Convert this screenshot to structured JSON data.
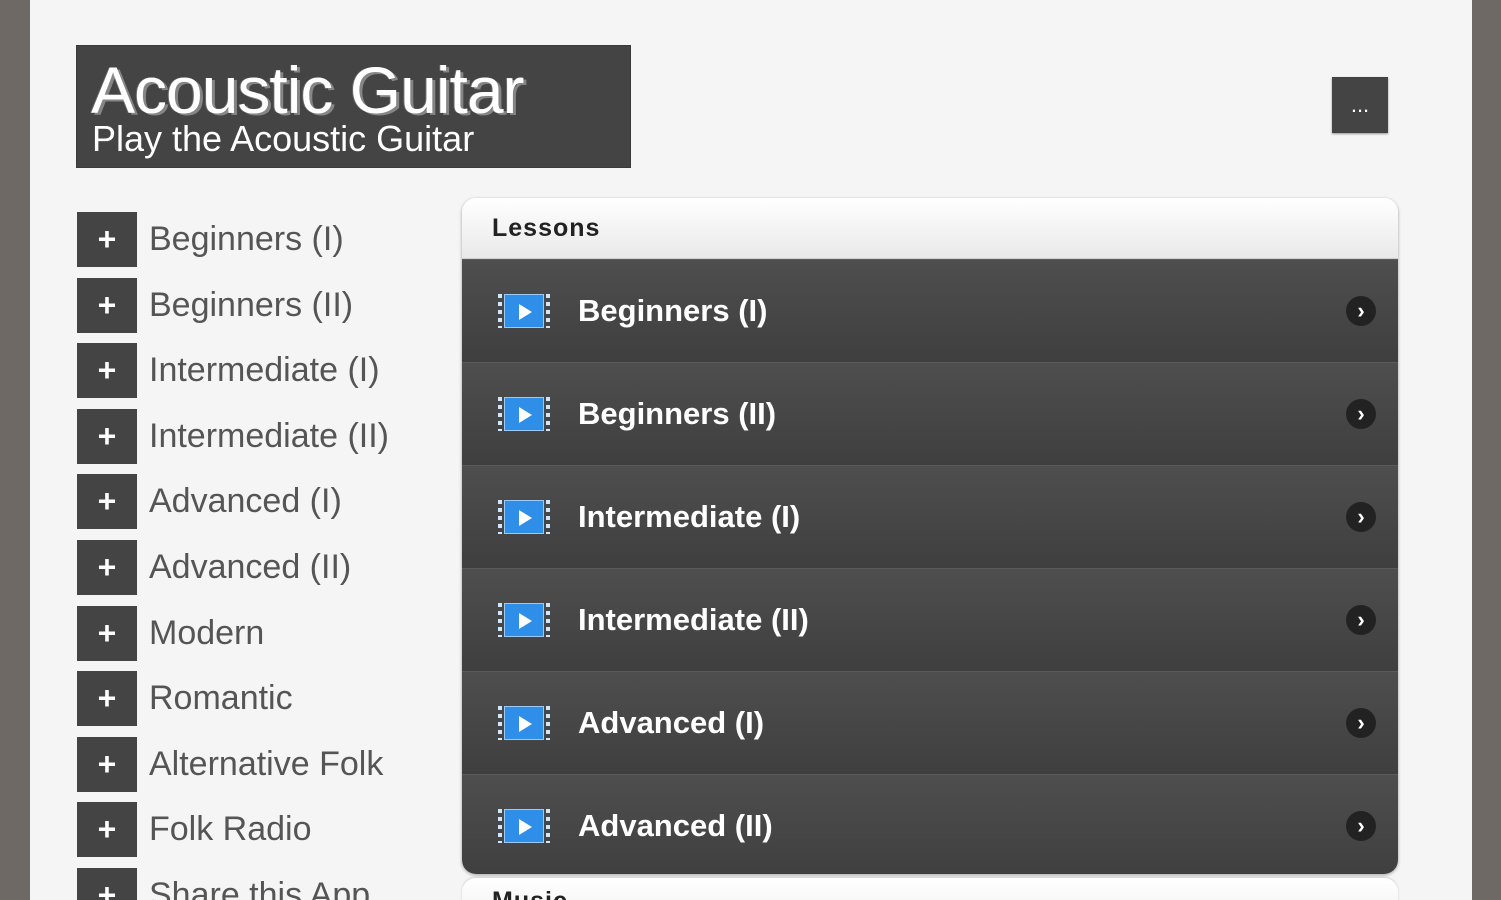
{
  "header": {
    "title": "Acoustic Guitar",
    "subtitle": "Play the Acoustic Guitar",
    "menu_label": "..."
  },
  "sidebar": {
    "items": [
      {
        "icon": "+",
        "label": "Beginners (I)"
      },
      {
        "icon": "+",
        "label": "Beginners (II)"
      },
      {
        "icon": "+",
        "label": "Intermediate (I)"
      },
      {
        "icon": "+",
        "label": "Intermediate (II)"
      },
      {
        "icon": "+",
        "label": "Advanced (I)"
      },
      {
        "icon": "+",
        "label": "Advanced (II)"
      },
      {
        "icon": "+",
        "label": "Modern"
      },
      {
        "icon": "+",
        "label": "Romantic"
      },
      {
        "icon": "+",
        "label": "Alternative Folk"
      },
      {
        "icon": "+",
        "label": "Folk Radio"
      },
      {
        "icon": "+",
        "label": "Share this App"
      }
    ]
  },
  "lessons": {
    "title": "Lessons",
    "items": [
      {
        "label": "Beginners (I)",
        "chevron": "›"
      },
      {
        "label": "Beginners (II)",
        "chevron": "›"
      },
      {
        "label": "Intermediate (I)",
        "chevron": "›"
      },
      {
        "label": "Intermediate (II)",
        "chevron": "›"
      },
      {
        "label": "Advanced (I)",
        "chevron": "›"
      },
      {
        "label": "Advanced (II)",
        "chevron": "›"
      }
    ]
  },
  "music": {
    "title": "Music"
  },
  "colors": {
    "background": "#6e6965",
    "page": "#f5f5f5",
    "dark_panel": "#444444",
    "video_icon": "#2e8ee8"
  }
}
